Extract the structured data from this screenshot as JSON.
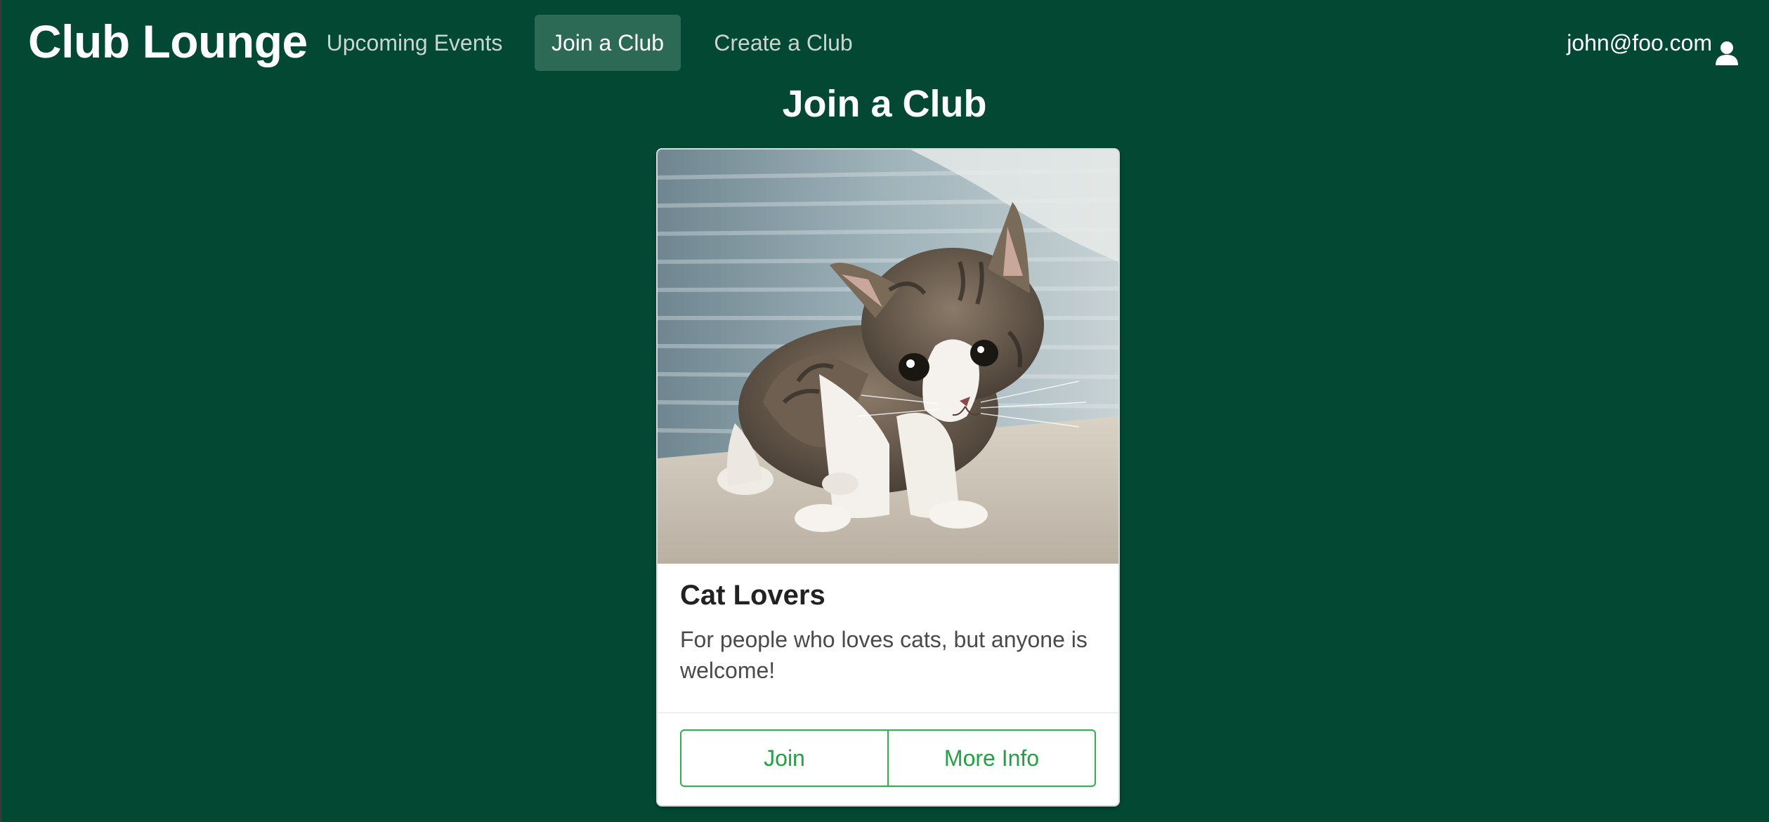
{
  "navbar": {
    "brand": "Club Lounge",
    "items": [
      {
        "label": "Upcoming Events",
        "active": false
      },
      {
        "label": "Join a Club",
        "active": true
      },
      {
        "label": "Create a Club",
        "active": false
      }
    ],
    "user": {
      "email": "john@foo.com",
      "icon": "user-icon"
    }
  },
  "page": {
    "title": "Join a Club"
  },
  "cards": [
    {
      "image": "kitten-photo",
      "title": "Cat Lovers",
      "description": "For people who loves cats, but anyone is welcome!",
      "buttons": {
        "join": "Join",
        "more_info": "More Info"
      }
    }
  ],
  "colors": {
    "background": "#024832",
    "nav_active_bg": "#2c6a55",
    "button_accent": "#2bb24c",
    "card_bg": "#ffffff"
  }
}
